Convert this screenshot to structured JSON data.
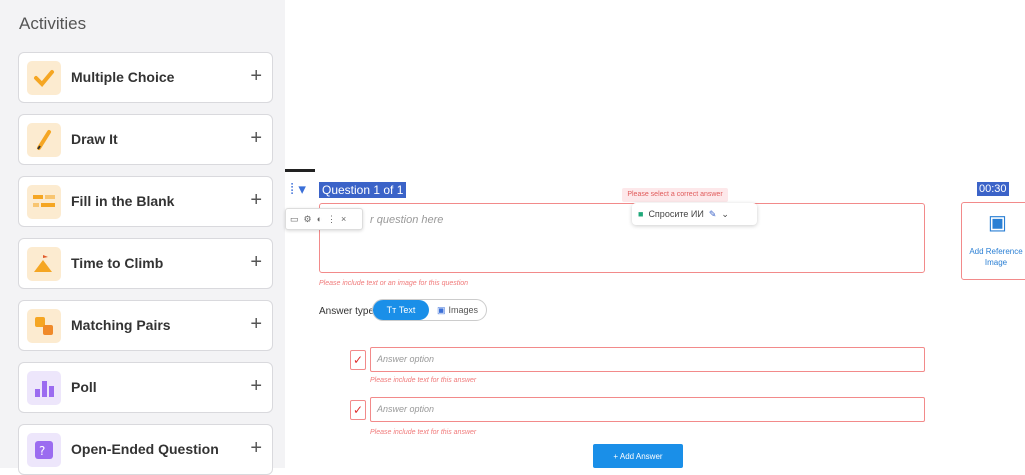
{
  "sidebar": {
    "title": "Activities",
    "items": [
      {
        "label": "Multiple Choice",
        "icon": "checkmark-icon",
        "color": "#fcebd0"
      },
      {
        "label": "Draw It",
        "icon": "pencil-icon",
        "color": "#fcebd0"
      },
      {
        "label": "Fill in the Blank",
        "icon": "fill-blank-icon",
        "color": "#fcebd0"
      },
      {
        "label": "Time to Climb",
        "icon": "mountain-icon",
        "color": "#fcebd0"
      },
      {
        "label": "Matching Pairs",
        "icon": "matching-icon",
        "color": "#fcebd0"
      },
      {
        "label": "Poll",
        "icon": "bar-chart-icon",
        "color": "#ede6fb"
      },
      {
        "label": "Open-Ended Question",
        "icon": "question-icon",
        "color": "#ede6fb"
      }
    ],
    "plus": "+"
  },
  "question": {
    "title": "Question 1 of 1",
    "error_top": "Please select a correct answer",
    "placeholder": "r question here",
    "error": "Please include text or an image for this question"
  },
  "ai_bar": {
    "label": "Спросите ИИ"
  },
  "answer_type": {
    "label": "Answer type",
    "text": "Text",
    "text_prefix": "Tт",
    "images": "Images"
  },
  "answers": [
    {
      "placeholder": "Answer option",
      "error": "Please include text for this answer"
    },
    {
      "placeholder": "Answer option",
      "error": "Please include text for this answer"
    }
  ],
  "add_answer": "+ Add Answer",
  "timer": "00:30",
  "reference": {
    "label": "Add Reference Image"
  }
}
